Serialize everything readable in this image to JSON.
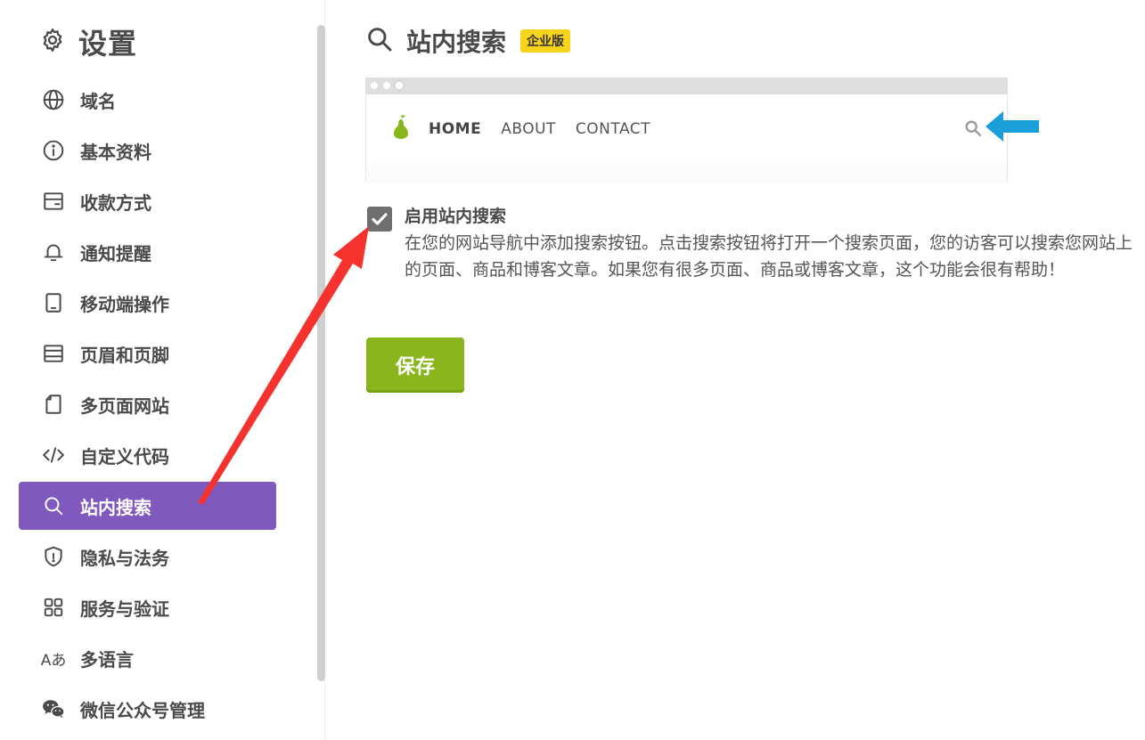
{
  "sidebar": {
    "title": "设置",
    "items": [
      {
        "label": "域名",
        "icon": "globe-icon"
      },
      {
        "label": "基本资料",
        "icon": "info-icon"
      },
      {
        "label": "收款方式",
        "icon": "wallet-icon"
      },
      {
        "label": "通知提醒",
        "icon": "bell-icon"
      },
      {
        "label": "移动端操作",
        "icon": "tablet-icon"
      },
      {
        "label": "页眉和页脚",
        "icon": "header-footer-icon"
      },
      {
        "label": "多页面网站",
        "icon": "page-icon"
      },
      {
        "label": "自定义代码",
        "icon": "code-icon"
      },
      {
        "label": "站内搜索",
        "icon": "search-icon",
        "active": true
      },
      {
        "label": "隐私与法务",
        "icon": "shield-icon"
      },
      {
        "label": "服务与验证",
        "icon": "grid-icon"
      },
      {
        "label": "多语言",
        "icon": "language-icon",
        "glyph": "Aあ"
      },
      {
        "label": "微信公众号管理",
        "icon": "wechat-icon"
      }
    ]
  },
  "main": {
    "title": "站内搜索",
    "badge": "企业版",
    "preview": {
      "nav": [
        "HOME",
        "ABOUT",
        "CONTACT"
      ]
    },
    "option": {
      "label": "启用站内搜索",
      "checked": true,
      "description": "在您的网站导航中添加搜索按钮。点击搜索按钮将打开一个搜索页面，您的访客可以搜索您网站上的页面、商品和博客文章。如果您有很多页面、商品或博客文章，这个功能会很有帮助！"
    },
    "save_label": "保存"
  },
  "colors": {
    "active": "#8059bf",
    "badge": "#f7d31c",
    "save": "#8ab51c",
    "pear": "#8ab51c",
    "annotation_arrow": "#f5322d",
    "pointer_arrow": "#1a9fd8"
  }
}
